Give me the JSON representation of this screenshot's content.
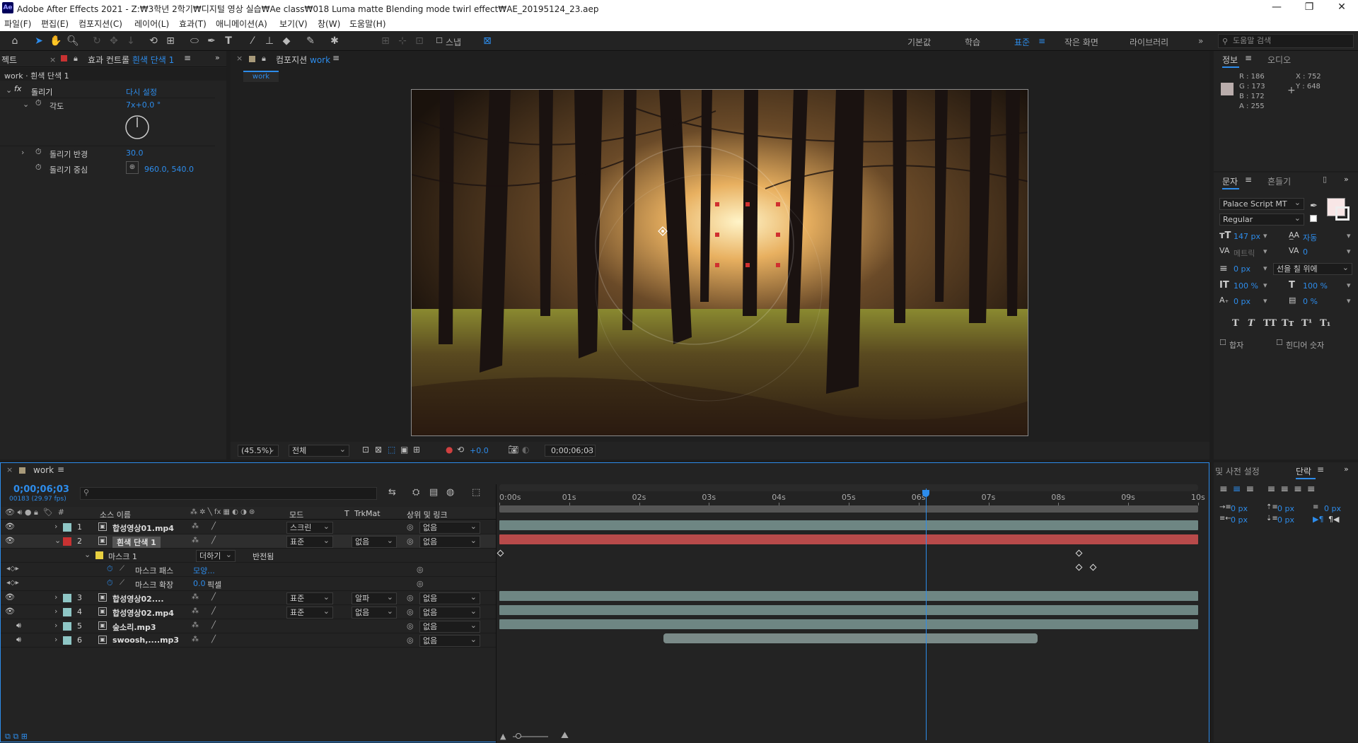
{
  "window": {
    "title": "Adobe After Effects 2021 - Z:₩3학년 2학기₩디지털 영상 실습₩Ae class₩018  Luma matte  Blending mode  twirl effect₩AE_20195124_23.aep",
    "icon": "Ae"
  },
  "menu": [
    "파일(F)",
    "편집(E)",
    "컴포지션(C)",
    "레이어(L)",
    "효과(T)",
    "애니메이션(A)",
    "보기(V)",
    "창(W)",
    "도움말(H)"
  ],
  "toolbar": {
    "snap_label": "스냅",
    "workspaces": [
      "기본값",
      "학습",
      "표준",
      "작은 화면",
      "라이브러리"
    ],
    "active_workspace": "표준",
    "search_placeholder": "도움말 검색"
  },
  "effects_panel": {
    "left_tab": "젝트",
    "tab_prefix": "효과 컨트롤",
    "tab_layer": "흰색 단색 1",
    "breadcrumb": "work · 흰색 단색 1",
    "effect_name": "돌리기",
    "reset_label": "다시 설정",
    "props": [
      {
        "name": "각도",
        "value": "7x+0.0 °"
      },
      {
        "name": "돌리기 반경",
        "value": "30.0"
      },
      {
        "name": "돌리기 중심",
        "value": "960.0, 540.0"
      }
    ]
  },
  "comp_panel": {
    "tab_prefix": "컴포지션",
    "tab_comp": "work",
    "sub_tab": "work",
    "zoom": "(45.5%)",
    "resolution": "전체",
    "exposure": "+0.0",
    "timecode": "0;00;06;03"
  },
  "info_panel": {
    "tabs": [
      "정보",
      "오디오"
    ],
    "r": "R : 186",
    "g": "G : 173",
    "b": "B : 172",
    "a": "A : 255",
    "x": "X : 752",
    "y": "Y : 648",
    "sample_color": "#baadac"
  },
  "character_panel": {
    "tabs": [
      "문자",
      "흔들기"
    ],
    "font": "Palace Script MT",
    "style": "Regular",
    "size": "147 px",
    "leading": "자동",
    "kerning": "메트릭",
    "tracking": "0",
    "stroke_width": "0 px",
    "stroke_mode": "선을 칠 위에",
    "vscale": "100 %",
    "hscale": "100 %",
    "baseline": "0 px",
    "tsume": "0 %",
    "style_buttons": [
      "T",
      "T",
      "TT",
      "Tт",
      "T¹",
      "T₁"
    ],
    "ligature_label": "합자",
    "hindi_label": "힌디어 숫자",
    "fill_color": "#f8e6e6"
  },
  "paragraph_panel": {
    "tabs": [
      "및 사전 설정",
      "단락"
    ],
    "indent_values": [
      "0 px",
      "0 px",
      "0 px",
      "0 px",
      "0 px"
    ]
  },
  "timeline": {
    "tab": "work",
    "timecode": "0;00;06;03",
    "frame_info": "00183 (29.97 fps)",
    "headers": {
      "source": "소스 이름",
      "mode": "모드",
      "t": "T",
      "trkmat": "TrkMat",
      "parent": "상위 및 링크"
    },
    "ruler": [
      "0:00s",
      "01s",
      "02s",
      "03s",
      "04s",
      "05s",
      "06s",
      "07s",
      "08s",
      "09s",
      "10s"
    ],
    "playhead_seconds": 6.1,
    "duration_seconds": 10,
    "layers": [
      {
        "num": "1",
        "name": "합성영상01.mp4",
        "mode": "스크린",
        "trkmat": "",
        "parent": "없음",
        "color": "#8ec6c5",
        "start": 0,
        "end": 10,
        "bar_color": "#6e8683"
      },
      {
        "num": "2",
        "name": "흰색 단색 1",
        "mode": "표준",
        "trkmat": "없음",
        "parent": "없음",
        "color": "#c83232",
        "start": 0,
        "end": 10,
        "bar_color": "#b84a4a"
      },
      {
        "num": "3",
        "name": "합성영상02....",
        "mode": "표준",
        "trkmat": "알파",
        "parent": "없음",
        "color": "#8ec6c5",
        "start": 0,
        "end": 10,
        "bar_color": "#6e8683"
      },
      {
        "num": "4",
        "name": "합성영상02.mp4",
        "mode": "표준",
        "trkmat": "없음",
        "parent": "없음",
        "color": "#8ec6c5",
        "start": 0,
        "end": 10,
        "bar_color": "#6e8683"
      },
      {
        "num": "5",
        "name": "숲소리.mp3",
        "mode": "",
        "trkmat": "",
        "parent": "없음",
        "color": "#8ec6c5",
        "start": 0,
        "end": 10,
        "bar_color": "#6e8683"
      },
      {
        "num": "6",
        "name": "swoosh,....mp3",
        "mode": "",
        "trkmat": "",
        "parent": "없음",
        "color": "#8ec6c5",
        "start": 2.35,
        "end": 7.7,
        "bar_color": "#7a8a88"
      }
    ],
    "mask": {
      "name": "마스크 1",
      "mode": "더하기",
      "inverted_label": "반전됨",
      "path_label": "마스크 패스",
      "path_value": "모양...",
      "expand_label": "마스크 확장",
      "expand_value": "0.0",
      "expand_unit": "픽셀"
    }
  }
}
